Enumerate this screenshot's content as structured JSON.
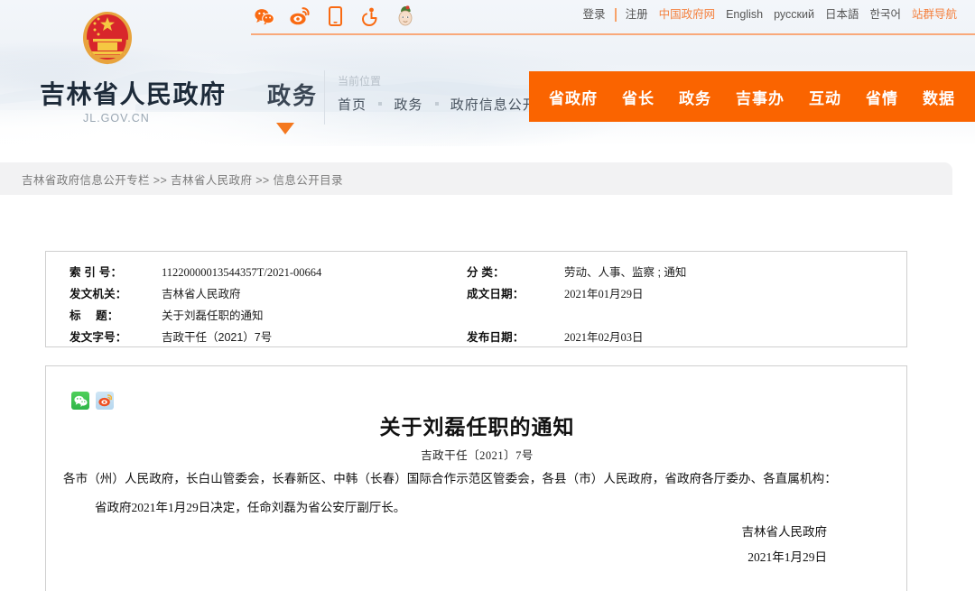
{
  "header": {
    "social_icons": [
      {
        "name": "wechat-icon",
        "label": "微信"
      },
      {
        "name": "weibo-icon",
        "label": "微博"
      },
      {
        "name": "mobile-icon",
        "label": "手机版"
      },
      {
        "name": "accessibility-icon",
        "label": "无障碍"
      },
      {
        "name": "elderly-mode-icon",
        "label": "长者模式"
      }
    ],
    "links": [
      {
        "label": "登录",
        "style": "gray"
      },
      {
        "label": "注册",
        "style": "gray"
      },
      {
        "label": "中国政府网",
        "style": "orange"
      },
      {
        "label": "English",
        "style": "gray"
      },
      {
        "label": "русский",
        "style": "gray"
      },
      {
        "label": "日本語",
        "style": "gray"
      },
      {
        "label": "한국어",
        "style": "gray"
      },
      {
        "label": "站群导航",
        "style": "orange"
      }
    ],
    "gov_name": "吉林省人民政府",
    "gov_url": "JL.GOV.CN",
    "section_word": "政务",
    "breadcrumb_label": "当前位置",
    "breadcrumb_items": [
      "首页",
      "政务",
      "政府信息公开"
    ],
    "nav_items": [
      "省政府",
      "省长",
      "政务",
      "吉事办",
      "互动",
      "省情",
      "数据"
    ],
    "accent_color": "#fa6400"
  },
  "strip": {
    "text": "吉林省政府信息公开专栏 >> 吉林省人民政府 >> 信息公开目录"
  },
  "meta": {
    "rows": [
      {
        "key_left": "索 引 号：",
        "val_left": "11220000013544357T/2021-00664",
        "key_right": "分 类：",
        "val_right": "劳动、人事、监察 ; 通知"
      },
      {
        "key_left": "发文机关：",
        "val_left": "吉林省人民政府",
        "key_right": "成文日期：",
        "val_right": "2021年01月29日"
      },
      {
        "key_left": "标 　题：",
        "val_left": "关于刘磊任职的通知",
        "key_right": "",
        "val_right": ""
      },
      {
        "key_left": "发文字号：",
        "val_left": "吉政干任（2021）7号",
        "key_right": "发布日期：",
        "val_right": "2021年02月03日"
      }
    ]
  },
  "document": {
    "share": [
      {
        "name": "share-wechat-icon",
        "label": "分享到微信"
      },
      {
        "name": "share-weibo-icon",
        "label": "分享到微博"
      }
    ],
    "title": "关于刘磊任职的通知",
    "number": "吉政干任〔2021〕7号",
    "paragraph1": "各市（州）人民政府，长白山管委会，长春新区、中韩（长春）国际合作示范区管委会，各县（市）人民政府，省政府各厅委办、各直属机构：",
    "paragraph2": "省政府2021年1月29日决定，任命刘磊为省公安厅副厅长。",
    "signature_org": "吉林省人民政府",
    "signature_date": "2021年1月29日"
  }
}
